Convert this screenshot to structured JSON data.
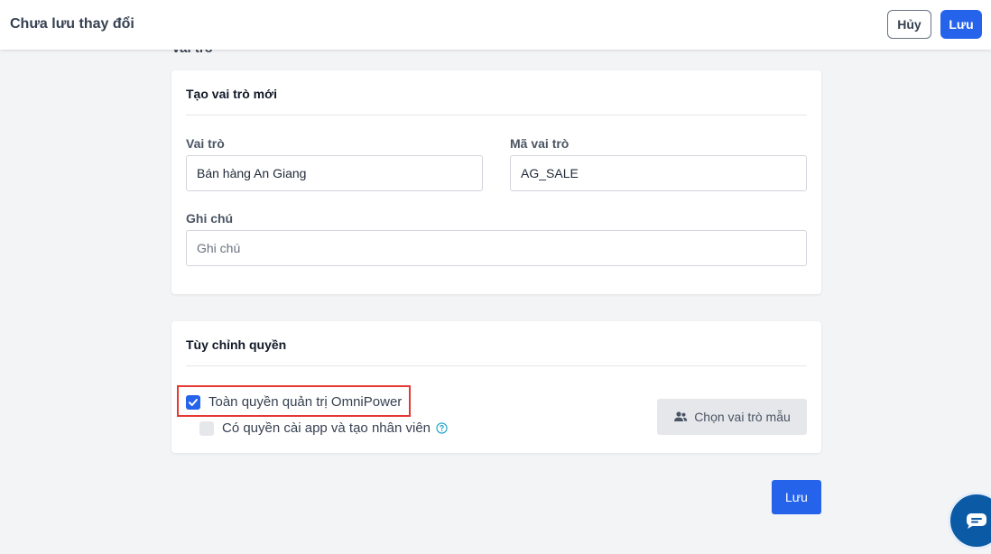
{
  "header": {
    "title": "Chưa lưu thay đổi",
    "cancel_label": "Hủy",
    "save_label": "Lưu"
  },
  "section_heading": "Vai trò",
  "new_role_card": {
    "title": "Tạo vai trò mới",
    "role_label": "Vai trò",
    "role_value": "Bán hàng An Giang",
    "code_label": "Mã vai trò",
    "code_value": "AG_SALE",
    "note_label": "Ghi chú",
    "note_placeholder": "Ghi chú",
    "note_value": ""
  },
  "permissions_card": {
    "title": "Tùy chỉnh quyền",
    "full_admin_label": "Toàn quyền quản trị OmniPower",
    "full_admin_checked": true,
    "install_app_label": "Có quyền cài app và tạo nhân viên",
    "install_app_checked": false,
    "template_button_label": "Chọn vai trò mẫu"
  },
  "footer": {
    "save_label": "Lưu"
  },
  "icons": {
    "checkbox": "check-icon",
    "help": "help-circle-icon",
    "template": "users-icon",
    "chat": "chat-icon"
  },
  "colors": {
    "primary": "#2563eb",
    "highlight": "#e53935",
    "chat": "#0b5aa6"
  }
}
